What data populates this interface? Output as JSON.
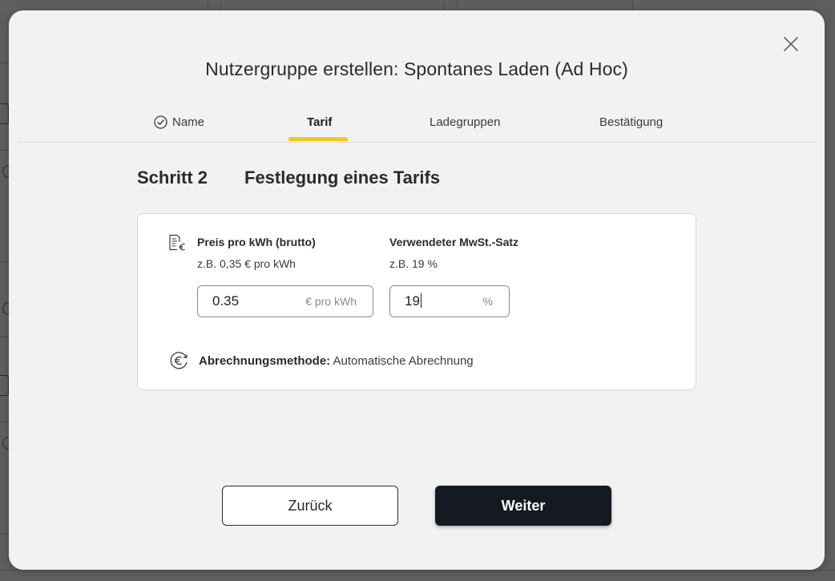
{
  "modal": {
    "title": "Nutzergruppe erstellen: Spontanes Laden (Ad Hoc)",
    "close_icon": "close-icon"
  },
  "tabs": [
    {
      "label": "Name",
      "state": "completed",
      "icon": "check-circle-icon"
    },
    {
      "label": "Tarif",
      "state": "active"
    },
    {
      "label": "Ladegruppen",
      "state": "upcoming"
    },
    {
      "label": "Bestätigung",
      "state": "upcoming"
    }
  ],
  "step": {
    "label": "Schritt 2",
    "title": "Festlegung eines Tarifs"
  },
  "price": {
    "icon": "invoice-euro-icon",
    "label": "Preis pro kWh (brutto)",
    "hint": "z.B. 0,35 € pro kWh",
    "value": "0.35",
    "unit": "€ pro kWh"
  },
  "vat": {
    "label": "Verwendeter MwSt.-Satz",
    "hint": "z.B. 19 %",
    "value": "19",
    "unit": "%"
  },
  "billing": {
    "icon": "euro-cycle-icon",
    "key": "Abrechnungsmethode:",
    "value": "Automatische Abrechnung"
  },
  "buttons": {
    "back_label": "Zurück",
    "next_label": "Weiter"
  },
  "colors": {
    "accent": "#f6c428",
    "primary_button": "#151a22",
    "modal_background": "#f2f2f2"
  }
}
